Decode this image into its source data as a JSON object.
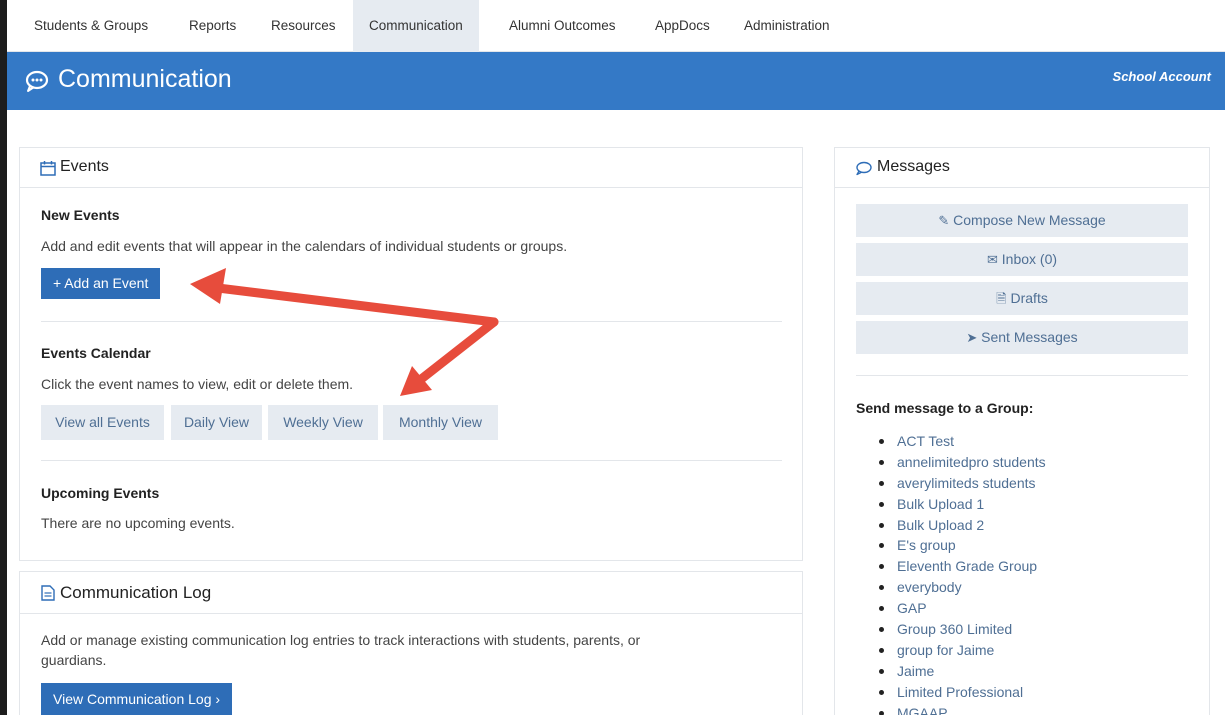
{
  "nav": {
    "items": [
      "Students & Groups",
      "Reports",
      "Resources",
      "Communication",
      "Alumni Outcomes",
      "AppDocs",
      "Administration"
    ]
  },
  "header": {
    "title": "Communication",
    "account": "School Account",
    "icon": "chat-bubble-icon"
  },
  "events": {
    "title": "Events",
    "icon": "calendar-icon",
    "new_title": "New Events",
    "new_text": "Add and edit events that will appear in the calendars of individual students or groups.",
    "add_button": "+ Add an Event",
    "calendar_title": "Events Calendar",
    "calendar_text": "Click the event names to view, edit or delete them.",
    "views": [
      "View all Events",
      "Daily View",
      "Weekly View",
      "Monthly View"
    ],
    "upcoming_title": "Upcoming Events",
    "upcoming_text": "There are no upcoming events."
  },
  "comm_log": {
    "title": "Communication Log",
    "icon": "document-icon",
    "text_line1": "Add or manage existing communication log entries to track interactions with students, parents, or",
    "text_line2": "guardians.",
    "button": "View Communication Log ›"
  },
  "messages": {
    "title": "Messages",
    "icon": "speech-bubble-icon",
    "compose": "Compose New Message",
    "inbox": "Inbox (0)",
    "drafts": "Drafts",
    "sent": "Sent Messages",
    "group_heading": "Send message to a Group:",
    "groups": [
      "ACT Test",
      "annelimitedpro students",
      "averylimiteds students",
      "Bulk Upload 1",
      "Bulk Upload 2",
      "E's group",
      "Eleventh Grade Group",
      "everybody",
      "GAP",
      "Group 360 Limited",
      "group for Jaime",
      "Jaime",
      "Limited Professional",
      "MGAAP"
    ]
  },
  "colors": {
    "primary": "#2e6db7",
    "header": "#3479c6",
    "light_button": "#e6ebf1",
    "link": "#4f6f94",
    "arrow": "#e74c3c"
  }
}
